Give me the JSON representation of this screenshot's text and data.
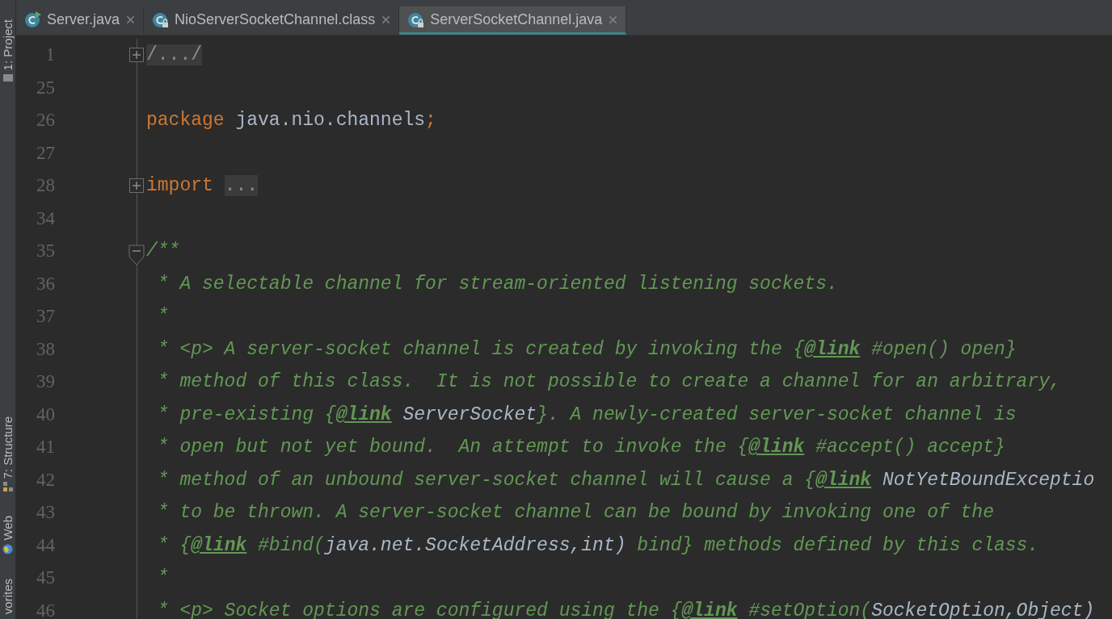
{
  "tool_windows": [
    {
      "label": "1: Project",
      "kind": "project"
    },
    {
      "label": "7: Structure",
      "kind": "structure"
    },
    {
      "label": "Web",
      "kind": "web"
    },
    {
      "label": "vorites",
      "kind": "favorites"
    }
  ],
  "tabs": [
    {
      "label": "Server.java",
      "selected": false,
      "kind": "runnable"
    },
    {
      "label": "NioServerSocketChannel.class",
      "selected": false,
      "kind": "locked"
    },
    {
      "label": "ServerSocketChannel.java",
      "selected": true,
      "kind": "locked"
    }
  ],
  "editor": {
    "lines": [
      {
        "number": "1",
        "kind": "folded",
        "tokens": [
          {
            "kind": "folded",
            "text": "/.../"
          }
        ]
      },
      {
        "number": "25",
        "kind": "plain"
      },
      {
        "number": "26",
        "kind": "plain",
        "tokens": [
          {
            "kind": "keyword",
            "text": "package"
          },
          {
            "kind": "plain",
            "text": " java.nio.channels"
          },
          {
            "kind": "keyword",
            "text": ";"
          }
        ]
      },
      {
        "number": "27",
        "kind": "plain"
      },
      {
        "number": "28",
        "kind": "folded",
        "tokens": [
          {
            "kind": "keyword",
            "text": "import"
          },
          {
            "kind": "folded",
            "text": "..."
          }
        ]
      },
      {
        "number": "34",
        "kind": "plain"
      },
      {
        "number": "35",
        "kind": "fold-start",
        "tokens": [
          {
            "kind": "comment",
            "text": "/**"
          }
        ]
      },
      {
        "number": "36",
        "kind": "plain",
        "tokens": [
          {
            "kind": "comment",
            "text": " * A selectable channel for stream-oriented listening sockets."
          }
        ]
      },
      {
        "number": "37",
        "kind": "plain",
        "tokens": [
          {
            "kind": "comment",
            "text": " *"
          }
        ]
      },
      {
        "number": "38",
        "kind": "plain",
        "tokens": [
          {
            "kind": "comment",
            "text": " * <p> A server-socket channel is created by invoking the {"
          },
          {
            "kind": "link",
            "text": "@link"
          },
          {
            "kind": "comment",
            "text": " #open() open}"
          }
        ]
      },
      {
        "number": "39",
        "kind": "plain",
        "tokens": [
          {
            "kind": "comment",
            "text": " * method of this class.  It is not possible to create a channel for an arbitrary,"
          }
        ]
      },
      {
        "number": "40",
        "kind": "plain",
        "tokens": [
          {
            "kind": "comment",
            "text": " * pre-existing {"
          },
          {
            "kind": "link",
            "text": "@link"
          },
          {
            "kind": "ref",
            "text": " ServerSocket"
          },
          {
            "kind": "comment",
            "text": "}. A newly-created server-socket channel is"
          }
        ]
      },
      {
        "number": "41",
        "kind": "plain",
        "tokens": [
          {
            "kind": "comment",
            "text": " * open but not yet bound.  An attempt to invoke the {"
          },
          {
            "kind": "link",
            "text": "@link"
          },
          {
            "kind": "comment",
            "text": " #accept() accept}"
          }
        ]
      },
      {
        "number": "42",
        "kind": "plain",
        "tokens": [
          {
            "kind": "comment",
            "text": " * method of an unbound server-socket channel will cause a {"
          },
          {
            "kind": "link",
            "text": "@link"
          },
          {
            "kind": "ref",
            "text": " NotYetBoundExceptio"
          }
        ]
      },
      {
        "number": "43",
        "kind": "plain",
        "tokens": [
          {
            "kind": "comment",
            "text": " * to be thrown. A server-socket channel can be bound by invoking one of the"
          }
        ]
      },
      {
        "number": "44",
        "kind": "plain",
        "tokens": [
          {
            "kind": "comment",
            "text": " * {"
          },
          {
            "kind": "link",
            "text": "@link"
          },
          {
            "kind": "comment",
            "text": " #bind("
          },
          {
            "kind": "ref",
            "text": "java.net.SocketAddress,int)"
          },
          {
            "kind": "comment",
            "text": " bind} methods defined by this class."
          }
        ]
      },
      {
        "number": "45",
        "kind": "plain",
        "tokens": [
          {
            "kind": "comment",
            "text": " *"
          }
        ]
      },
      {
        "number": "46",
        "kind": "plain",
        "tokens": [
          {
            "kind": "comment",
            "text": " * <p> Socket options are configured using the {"
          },
          {
            "kind": "link",
            "text": "@link"
          },
          {
            "kind": "comment",
            "text": " #setOption("
          },
          {
            "kind": "ref",
            "text": "SocketOption,Object)"
          }
        ]
      }
    ]
  }
}
